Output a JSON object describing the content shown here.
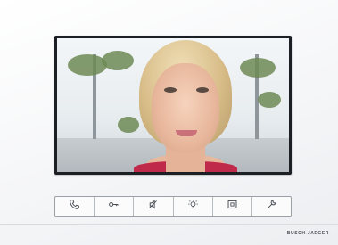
{
  "device": {
    "brand": "BUSCH-JAEGER",
    "buttons": [
      {
        "icon": "phone-icon"
      },
      {
        "icon": "key-icon"
      },
      {
        "icon": "mute-icon"
      },
      {
        "icon": "light-icon"
      },
      {
        "icon": "screen-icon"
      },
      {
        "icon": "wrench-icon"
      }
    ]
  }
}
